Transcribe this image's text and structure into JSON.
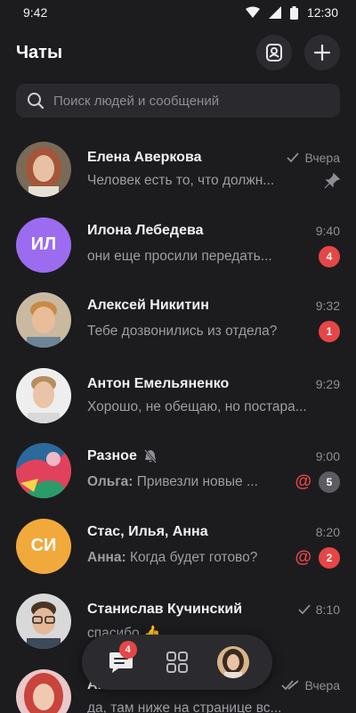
{
  "status": {
    "left_time": "9:42",
    "right_time": "12:30"
  },
  "header": {
    "title": "Чаты"
  },
  "search": {
    "placeholder": "Поиск людей и сообщений"
  },
  "chats": [
    {
      "name": "Елена Аверкова",
      "time": "Вчера",
      "preview": "Человек есть то, что должн...",
      "read": true,
      "pinned": true
    },
    {
      "name": "Илона Лебедева",
      "initials": "ИЛ",
      "avatar_color": "#9c6cf0",
      "time": "9:40",
      "preview": "они еще просили передать...",
      "unread": "4"
    },
    {
      "name": "Алексей Никитин",
      "time": "9:32",
      "preview": "Тебе дозвонились из отдела?",
      "unread": "1"
    },
    {
      "name": "Антон Емельяненко",
      "time": "9:29",
      "preview": "Хорошо, не обещаю, но постара..."
    },
    {
      "name": "Разное",
      "muted": true,
      "time": "9:00",
      "sender": "Ольга:",
      "preview": "Привезли новые ...",
      "mention": "@",
      "unread": "5"
    },
    {
      "name": "Стас, Илья, Анна",
      "initials": "СИ",
      "avatar_color": "#f2a93b",
      "time": "8:20",
      "sender": "Анна:",
      "preview": "Когда будет готово?",
      "mention": "@",
      "unread": "2"
    },
    {
      "name": "Станислав Кучинский",
      "time": "8:10",
      "preview": "спасибо 👍",
      "read": true
    },
    {
      "name": "А...",
      "time": "Вчера",
      "preview": "да, там ниже на странице вс...",
      "read": true,
      "double_check": true
    }
  ],
  "nav": {
    "chats_badge": "4"
  },
  "colors": {
    "background": "#1c1c1f",
    "accent_red": "#e64646",
    "surface": "#2b2b2f"
  }
}
